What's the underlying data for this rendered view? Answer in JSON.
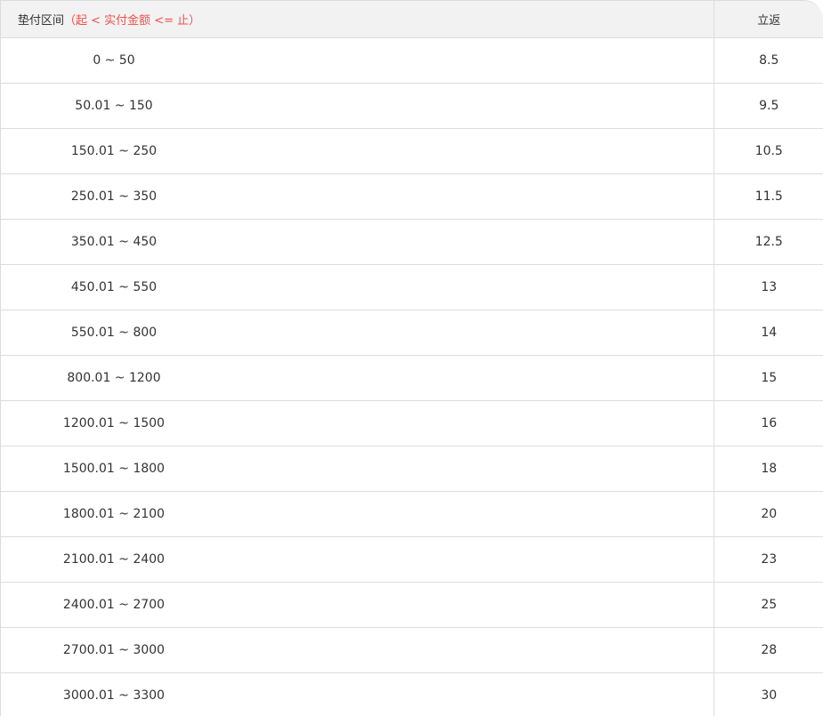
{
  "header": {
    "range_label": "垫付区间",
    "range_hint": "（起 < 实付金额 <= 止）",
    "rebate_label": "立返"
  },
  "rows": [
    {
      "range": "0 ~ 50",
      "rebate": "8.5"
    },
    {
      "range": "50.01 ~ 150",
      "rebate": "9.5"
    },
    {
      "range": "150.01 ~ 250",
      "rebate": "10.5"
    },
    {
      "range": "250.01 ~ 350",
      "rebate": "11.5"
    },
    {
      "range": "350.01 ~ 450",
      "rebate": "12.5"
    },
    {
      "range": "450.01 ~ 550",
      "rebate": "13"
    },
    {
      "range": "550.01 ~ 800",
      "rebate": "14"
    },
    {
      "range": "800.01 ~ 1200",
      "rebate": "15"
    },
    {
      "range": "1200.01 ~ 1500",
      "rebate": "16"
    },
    {
      "range": "1500.01 ~ 1800",
      "rebate": "18"
    },
    {
      "range": "1800.01 ~ 2100",
      "rebate": "20"
    },
    {
      "range": "2100.01 ~ 2400",
      "rebate": "23"
    },
    {
      "range": "2400.01 ~ 2700",
      "rebate": "25"
    },
    {
      "range": "2700.01 ~ 3000",
      "rebate": "28"
    },
    {
      "range": "3000.01 ~ 3300",
      "rebate": "30"
    }
  ]
}
